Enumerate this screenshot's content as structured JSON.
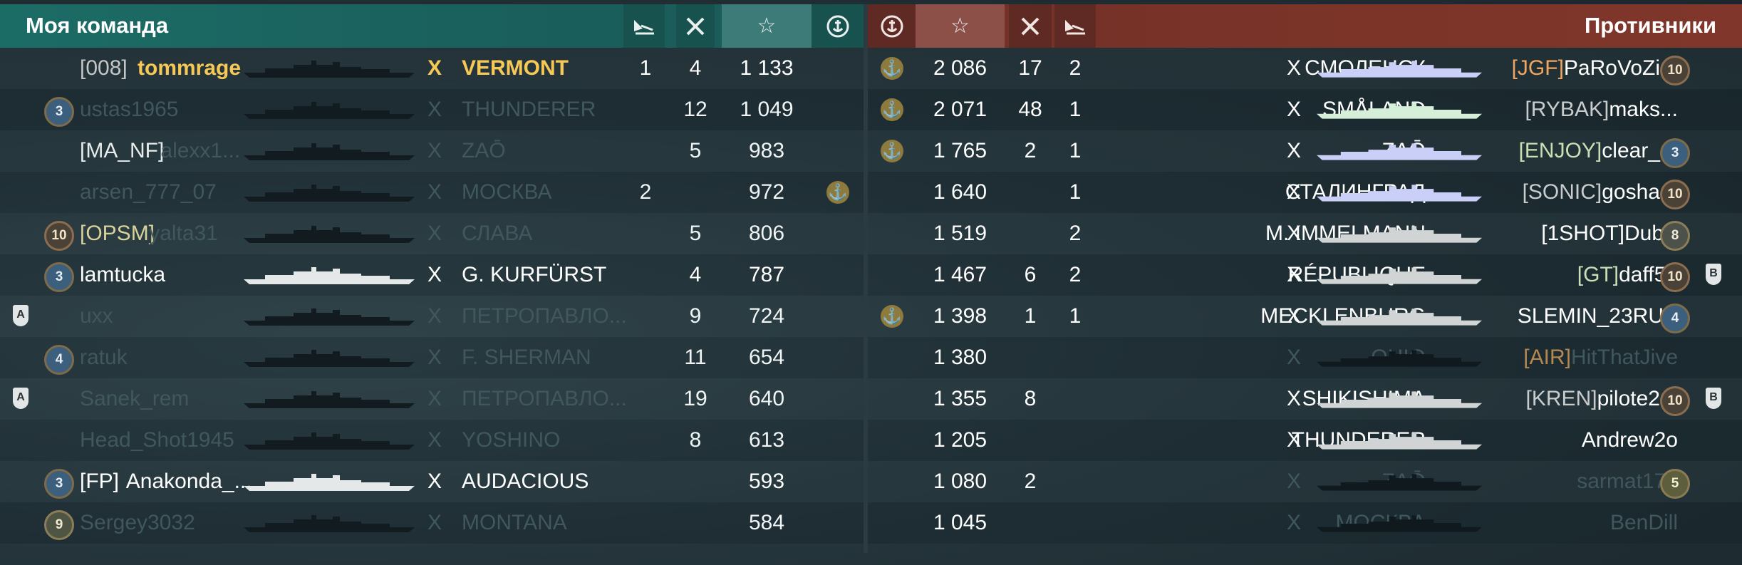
{
  "left_panel": {
    "title": "Моя команда",
    "columns": {
      "planes_icon": "planes-icon",
      "kills_icon": "kills-icon",
      "xp_icon": "☆",
      "achievement_icon": "anchor-icon"
    },
    "rows": [
      {
        "badge": "",
        "shield": "",
        "clan": "[008]",
        "name": "tommrage",
        "tier": "X",
        "ship": "VERMONT",
        "planes": "1",
        "kills": "4",
        "xp": "1 133",
        "achievement": false,
        "state": "me"
      },
      {
        "badge": "3",
        "shield": "",
        "clan": "",
        "name": "ustas1965",
        "tier": "X",
        "ship": "THUNDERER",
        "planes": "",
        "kills": "12",
        "xp": "1 049",
        "achievement": false,
        "state": "dead"
      },
      {
        "badge": "",
        "shield": "",
        "clan": "[MA_NF]",
        "name": "alexx1...",
        "tier": "X",
        "ship": "ZAŌ",
        "planes": "",
        "kills": "5",
        "xp": "983",
        "achievement": false,
        "state": "dead"
      },
      {
        "badge": "",
        "shield": "",
        "clan": "",
        "name": "arsen_777_07",
        "tier": "X",
        "ship": "МОСКВА",
        "planes": "2",
        "kills": "",
        "xp": "972",
        "achievement": true,
        "state": "dead"
      },
      {
        "badge": "10",
        "shield": "",
        "clan": "[OPSM]",
        "name": "yalta31",
        "tier": "X",
        "ship": "СЛАВА",
        "planes": "",
        "kills": "5",
        "xp": "806",
        "achievement": false,
        "state": "dead"
      },
      {
        "badge": "3",
        "shield": "",
        "clan": "",
        "name": "lamtucka",
        "tier": "X",
        "ship": "G. KURFÜRST",
        "planes": "",
        "kills": "4",
        "xp": "787",
        "achievement": false,
        "state": "alive"
      },
      {
        "badge": "",
        "shield": "A",
        "clan": "",
        "name": "uxx",
        "tier": "X",
        "ship": "ПЕТРОПАВЛО...",
        "planes": "",
        "kills": "9",
        "xp": "724",
        "achievement": false,
        "state": "dead"
      },
      {
        "badge": "4",
        "shield": "",
        "clan": "",
        "name": "ratuk",
        "tier": "X",
        "ship": "F. SHERMAN",
        "planes": "",
        "kills": "11",
        "xp": "654",
        "achievement": false,
        "state": "dead"
      },
      {
        "badge": "",
        "shield": "A",
        "clan": "",
        "name": "Sanek_rem",
        "tier": "X",
        "ship": "ПЕТРОПАВЛО...",
        "planes": "",
        "kills": "19",
        "xp": "640",
        "achievement": false,
        "state": "dead"
      },
      {
        "badge": "",
        "shield": "",
        "clan": "",
        "name": "Head_Shot1945",
        "tier": "X",
        "ship": "YOSHINO",
        "planes": "",
        "kills": "8",
        "xp": "613",
        "achievement": false,
        "state": "dead"
      },
      {
        "badge": "3",
        "shield": "",
        "clan": "[FP]",
        "name": "Anakonda_...",
        "tier": "X",
        "ship": "AUDACIOUS",
        "planes": "",
        "kills": "",
        "xp": "593",
        "achievement": false,
        "state": "alive"
      },
      {
        "badge": "9",
        "shield": "",
        "clan": "",
        "name": "Sergey3032",
        "tier": "X",
        "ship": "MONTANA",
        "planes": "",
        "kills": "",
        "xp": "584",
        "achievement": false,
        "state": "dead"
      }
    ]
  },
  "right_panel": {
    "title": "Противники",
    "columns": {
      "achievement_icon": "anchor-icon",
      "xp_icon": "☆",
      "kills_icon": "kills-icon",
      "planes_icon": "planes-icon"
    },
    "rows": [
      {
        "achievement": true,
        "xp": "2 086",
        "kills": "17",
        "planes": "2",
        "ship": "СМОЛЕНСК",
        "tier": "X",
        "clan": "[JGF]",
        "name": "PaRoVoZi...",
        "badge": "10",
        "shield": "",
        "state": "alive",
        "ship_color": "#c9cff6"
      },
      {
        "achievement": true,
        "xp": "2 071",
        "kills": "48",
        "planes": "1",
        "ship": "SMÅLAND",
        "tier": "X",
        "clan": "[RYBAK]",
        "name": "maks...",
        "badge": "",
        "shield": "",
        "state": "alive",
        "ship_color": "#d6efd9"
      },
      {
        "achievement": true,
        "xp": "1 765",
        "kills": "2",
        "planes": "1",
        "ship": "ZAŌ",
        "tier": "X",
        "clan": "[ENJOY]",
        "name": "clear_...",
        "badge": "3",
        "shield": "",
        "state": "alive",
        "ship_color": "#c9cff6"
      },
      {
        "achievement": false,
        "xp": "1 640",
        "kills": "",
        "planes": "1",
        "ship": "СТАЛИНГРАД",
        "tier": "X",
        "clan": "[SONIC]",
        "name": "gosha...",
        "badge": "10",
        "shield": "",
        "state": "alive",
        "ship_color": "#c9cff6"
      },
      {
        "achievement": false,
        "xp": "1 519",
        "kills": "",
        "planes": "2",
        "ship": "M. IMMELMANN",
        "tier": "X",
        "clan": "[1SHOT]",
        "name": "Dublii",
        "badge": "8",
        "shield": "",
        "state": "alive",
        "ship_color": "#d0d4d4"
      },
      {
        "achievement": false,
        "xp": "1 467",
        "kills": "6",
        "planes": "2",
        "ship": "RÉPUBLIQUE",
        "tier": "X",
        "clan": "[GT]",
        "name": "daff51",
        "badge": "10",
        "shield": "B",
        "state": "alive",
        "ship_color": "#d0d4d4"
      },
      {
        "achievement": true,
        "xp": "1 398",
        "kills": "1",
        "planes": "1",
        "ship": "MECKLENBURG",
        "tier": "X",
        "clan": "",
        "name": "SLEMIN_23RUS",
        "badge": "4",
        "shield": "",
        "state": "alive",
        "ship_color": "#d0d4d4"
      },
      {
        "achievement": false,
        "xp": "1 380",
        "kills": "",
        "planes": "",
        "ship": "OHIO",
        "tier": "X",
        "clan": "[AIR]",
        "name": "HitThatJive",
        "badge": "",
        "shield": "",
        "state": "dead",
        "ship_color": "#101a1e"
      },
      {
        "achievement": false,
        "xp": "1 355",
        "kills": "8",
        "planes": "",
        "ship": "SHIKISHIMA",
        "tier": "X",
        "clan": "[KREN]",
        "name": "pilote2...",
        "badge": "10",
        "shield": "B",
        "state": "alive",
        "ship_color": "#d0d4d4"
      },
      {
        "achievement": false,
        "xp": "1 205",
        "kills": "",
        "planes": "",
        "ship": "THUNDERER",
        "tier": "X",
        "clan": "",
        "name": "Andrew2o",
        "badge": "",
        "shield": "",
        "state": "alive",
        "ship_color": "#d0d4d4"
      },
      {
        "achievement": false,
        "xp": "1 080",
        "kills": "2",
        "planes": "",
        "ship": "ZAŌ",
        "tier": "X",
        "clan": "",
        "name": "sarmat172",
        "badge": "5",
        "shield": "",
        "state": "dead",
        "ship_color": "#101a1e"
      },
      {
        "achievement": false,
        "xp": "1 045",
        "kills": "",
        "planes": "",
        "ship": "МОСКВА",
        "tier": "X",
        "clan": "",
        "name": "BenDill",
        "badge": "",
        "shield": "",
        "state": "dead",
        "ship_color": "#101a1e"
      }
    ]
  },
  "colors": {
    "me": "#f6c957",
    "alive": "#ffffff",
    "dead": "#40575e",
    "dead_clan": "#5f5a3c",
    "enemy_clan_tag": "#f0a560",
    "ally_clan_tag": "#e7e1b2",
    "teal_header": "#1b6763",
    "red_header": "#7a3328"
  }
}
